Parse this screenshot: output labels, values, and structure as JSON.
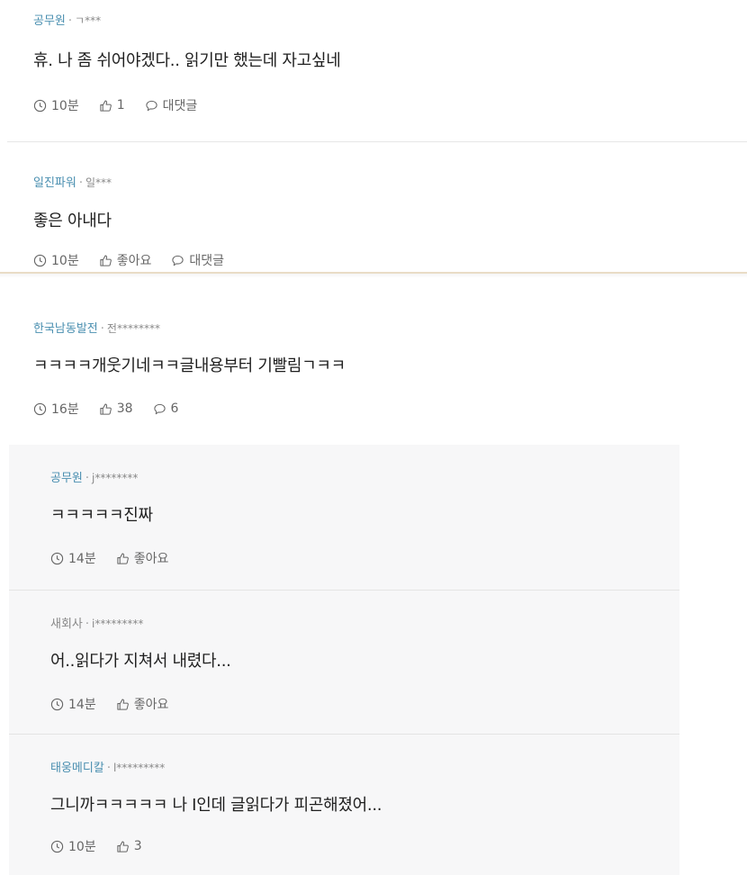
{
  "comments": [
    {
      "author": "공무원",
      "user_id": "ㄱ***",
      "text": "휴. 나 좀 쉬어야겠다.. 읽기만 했는데 자고싶네",
      "time": "10분",
      "likes": "1",
      "reply_label": "대댓글"
    },
    {
      "author": "일진파워",
      "user_id": "일***",
      "text": "좋은 아내다",
      "time": "10분",
      "likes": "좋아요",
      "reply_label": "대댓글"
    },
    {
      "author": "한국남동발전",
      "user_id": "전********",
      "text": "ㅋㅋㅋㅋ개웃기네ㅋㅋ글내용부터 기빨림ㄱㅋㅋ",
      "time": "16분",
      "likes": "38",
      "reply_count": "6"
    }
  ],
  "replies": [
    {
      "author": "공무원",
      "user_id": "j********",
      "text": "ㅋㅋㅋㅋㅋ진짜",
      "time": "14분",
      "likes": "좋아요"
    },
    {
      "author": "새회사",
      "user_id": "i*********",
      "text": "어..읽다가 지쳐서 내렸다...",
      "time": "14분",
      "likes": "좋아요"
    },
    {
      "author": "태웅메디칼",
      "user_id": "l*********",
      "text": "그니까ㅋㅋㅋㅋㅋ 나 I인데 글읽다가 피곤해졌어...",
      "time": "10분",
      "likes": "3"
    }
  ],
  "icons": {
    "time": "clock-icon",
    "like": "thumbs-up-icon",
    "reply": "speech-bubble-icon"
  },
  "colors": {
    "author_link": "#4a8fb0",
    "reply_bg": "#f7f7f8",
    "meta_text": "#666666"
  }
}
